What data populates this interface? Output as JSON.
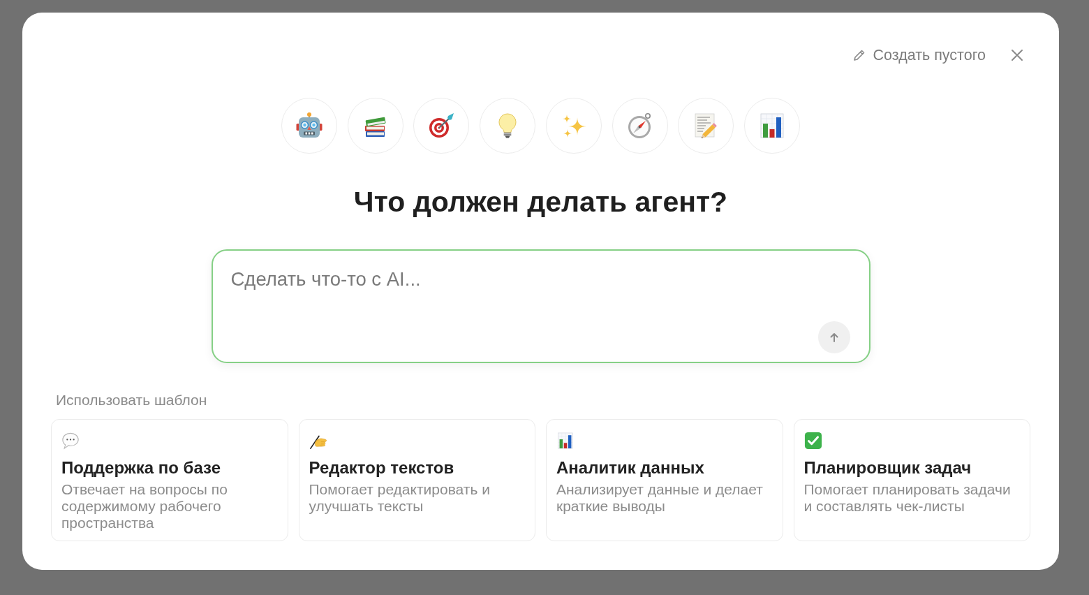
{
  "header": {
    "create_blank": "Создать пустого"
  },
  "emoji_choices": [
    {
      "kind": "robot"
    },
    {
      "kind": "books"
    },
    {
      "kind": "target"
    },
    {
      "kind": "lightbulb"
    },
    {
      "kind": "sparkles"
    },
    {
      "kind": "compass"
    },
    {
      "kind": "memo"
    },
    {
      "kind": "chart"
    }
  ],
  "heading": "Что должен делать агент?",
  "prompt": {
    "placeholder": "Сделать что-то с AI..."
  },
  "templates": {
    "label": "Использовать шаблон",
    "items": [
      {
        "kind": "speech",
        "title": "Поддержка по базе",
        "description": "Отвечает на вопросы по содержимому рабочего пространства"
      },
      {
        "kind": "writing",
        "title": "Редактор текстов",
        "description": "Помогает редактировать и улучшать тексты"
      },
      {
        "kind": "chart",
        "title": "Аналитик данных",
        "description": "Анализирует данные и делает краткие выводы"
      },
      {
        "kind": "check",
        "title": "Планировщик задач",
        "description": "Помогает планировать задачи и составлять чек-листы"
      }
    ]
  }
}
